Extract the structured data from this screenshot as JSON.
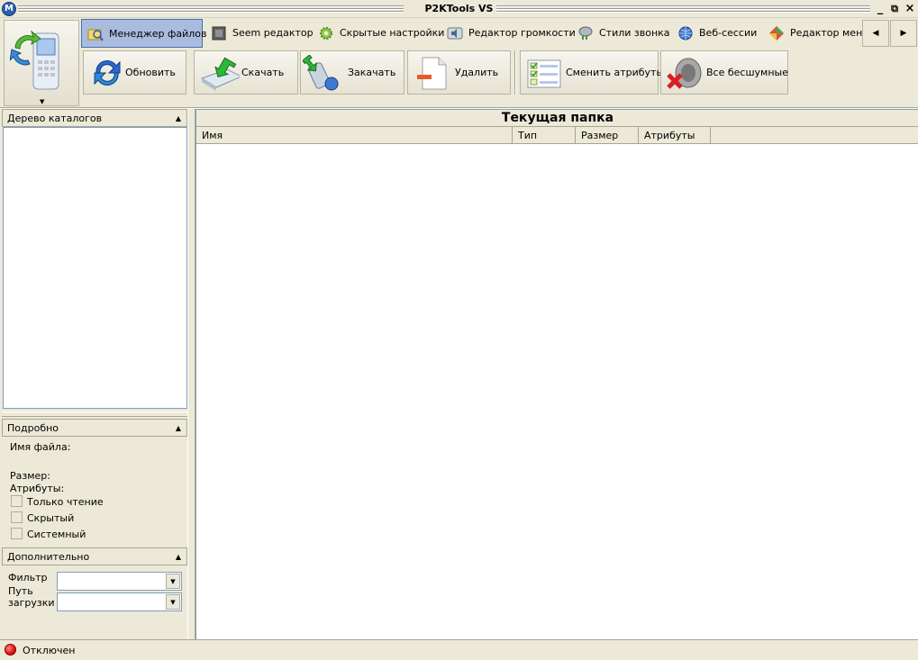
{
  "window": {
    "title": "P2KTools VS"
  },
  "tabs": [
    {
      "label": "Менеджер файлов",
      "icon": "file-manager-icon",
      "active": true
    },
    {
      "label": "Seem редактор",
      "icon": "seem-editor-icon"
    },
    {
      "label": "Скрытые настройки",
      "icon": "hidden-settings-gear-icon"
    },
    {
      "label": "Редактор громкости",
      "icon": "volume-editor-icon"
    },
    {
      "label": "Стили звонка",
      "icon": "ring-style-icon"
    },
    {
      "label": "Веб-сессии",
      "icon": "web-sessions-globe-icon"
    },
    {
      "label": "Редактор меню",
      "icon": "menu-editor-icon"
    }
  ],
  "actions": {
    "refresh": "Обновить",
    "download": "Скачать",
    "upload": "Закачать",
    "delete": "Удалить",
    "change_attributes": "Сменить атрибуты",
    "all_silent": "Все бесшумные"
  },
  "left_panel": {
    "tree_title": "Дерево каталогов",
    "details_title": "Подробно",
    "file_name_label": "Имя файла:",
    "size_label": "Размер:",
    "attributes_label": "Атрибуты:",
    "attributes": [
      "Только чтение",
      "Скрытый",
      "Системный"
    ],
    "extra_title": "Дополнительно",
    "filter_label": "Фильтр",
    "upload_path_label_1": "Путь",
    "upload_path_label_2": "загрузки"
  },
  "main": {
    "folder_title": "Текущая папка",
    "columns": [
      "Имя",
      "Тип",
      "Размер",
      "Атрибуты"
    ]
  },
  "status": {
    "text": "Отключен",
    "color": "#e01010"
  }
}
